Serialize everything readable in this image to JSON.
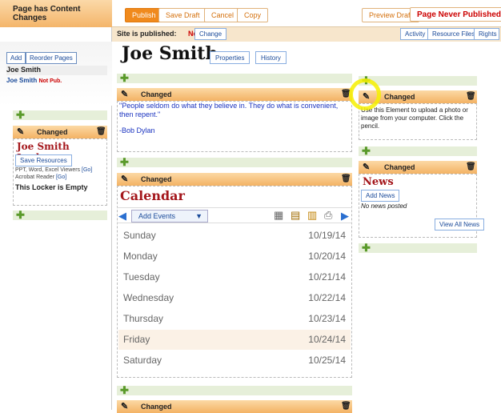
{
  "header": {
    "status_label": "Page has Content Changes",
    "publish": "Publish",
    "save_draft": "Save Draft",
    "cancel": "Cancel",
    "copy": "Copy",
    "preview_draft": "Preview Draft",
    "never_published": "Page Never Published"
  },
  "subheader": {
    "site_published_label": "Site is published:",
    "site_published_value": "No",
    "change": "Change",
    "activity": "Activity",
    "resource_files": "Resource Files",
    "rights": "Rights"
  },
  "sidebar": {
    "add": "Add",
    "reorder": "Reorder Pages",
    "page_title": "Joe Smith",
    "page_link": "Joe Smith",
    "not_pub": "Not Pub."
  },
  "page": {
    "title": "Joe Smith",
    "properties": "Properties",
    "history": "History"
  },
  "changed": "Changed",
  "locker": {
    "title": "Joe Smith Locker",
    "save_resources": "Save Resources",
    "line1": "PPT, Word, Excel Viewers",
    "go1": "[Go]",
    "line2": "Acrobat Reader",
    "go2": "[Go]",
    "empty": "This Locker is Empty"
  },
  "quote": {
    "text": "\"People seldom do what they believe in. They do what is convenient, then repent.\"",
    "author": "-Bob Dylan"
  },
  "calendar": {
    "title": "Calendar",
    "add_events": "Add Events",
    "days": [
      {
        "day": "Sunday",
        "date": "10/19/14"
      },
      {
        "day": "Monday",
        "date": "10/20/14"
      },
      {
        "day": "Tuesday",
        "date": "10/21/14"
      },
      {
        "day": "Wednesday",
        "date": "10/22/14"
      },
      {
        "day": "Thursday",
        "date": "10/23/14"
      },
      {
        "day": "Friday",
        "date": "10/24/14"
      },
      {
        "day": "Saturday",
        "date": "10/25/14"
      }
    ],
    "highlight_day": "Friday"
  },
  "photo": {
    "text": "Use this Element to upload a photo or image from your computer. Click the pencil."
  },
  "news": {
    "title": "News",
    "add_news": "Add News",
    "none": "No news posted",
    "view_all": "View All News"
  },
  "colors": {
    "accent_orange": "#f08a1d",
    "changed_bar": "#f3b264",
    "title_red": "#a4171c",
    "add_bar_green": "#e6efd9",
    "highlight_ring": "#f6f000"
  }
}
